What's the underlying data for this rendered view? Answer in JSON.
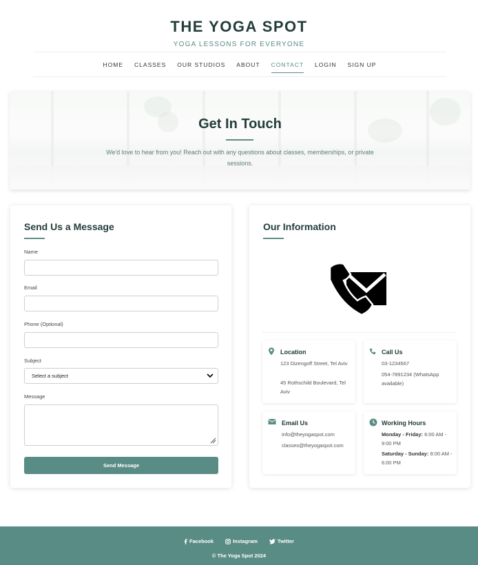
{
  "header": {
    "brand": "THE YOGA SPOT",
    "tagline": "YOGA LESSONS FOR EVERYONE",
    "nav": [
      "HOME",
      "CLASSES",
      "OUR STUDIOS",
      "ABOUT",
      "CONTACT",
      "LOGIN",
      "SIGN UP"
    ],
    "active_nav": "CONTACT"
  },
  "hero": {
    "title": "Get In Touch",
    "text": "We'd love to hear from you! Reach out with any questions about classes, memberships, or private sessions."
  },
  "form": {
    "title": "Send Us a Message",
    "name_label": "Name",
    "email_label": "Email",
    "phone_label": "Phone (Optional)",
    "subject_label": "Subject",
    "subject_value": "Select a subject",
    "message_label": "Message",
    "submit_label": "Send Message"
  },
  "info": {
    "title": "Our Information",
    "location": {
      "title": "Location",
      "lines": [
        "123 Dizengoff Street, Tel Aviv",
        "45 Rothschild Boulevard, Tel Aviv"
      ]
    },
    "call": {
      "title": "Call Us",
      "lines": [
        "03-1234567",
        "054-7891234 (WhatsApp available)"
      ]
    },
    "email": {
      "title": "Email Us",
      "lines": [
        "info@theyogaspot.com",
        "classes@theyogaspot.com"
      ]
    },
    "hours": {
      "title": "Working Hours",
      "weekday_label": "Monday - Friday:",
      "weekday_hours": "6:00 AM - 9:00 PM",
      "weekend_label": "Saturday - Sunday:",
      "weekend_hours": "8:00 AM - 6:00 PM"
    }
  },
  "footer": {
    "links": [
      "Facebook",
      "Instagram",
      "Twitter"
    ],
    "copyright": "© The Yoga Spot 2024"
  },
  "colors": {
    "accent": "#5a8c86",
    "heading": "#233d3a"
  },
  "icons": [
    "map-pin-icon",
    "phone-icon",
    "envelope-icon",
    "clock-icon",
    "chevron-down-icon",
    "resize-handle-icon",
    "handshake-envelope-logo",
    "facebook-icon",
    "instagram-icon",
    "twitter-icon"
  ]
}
